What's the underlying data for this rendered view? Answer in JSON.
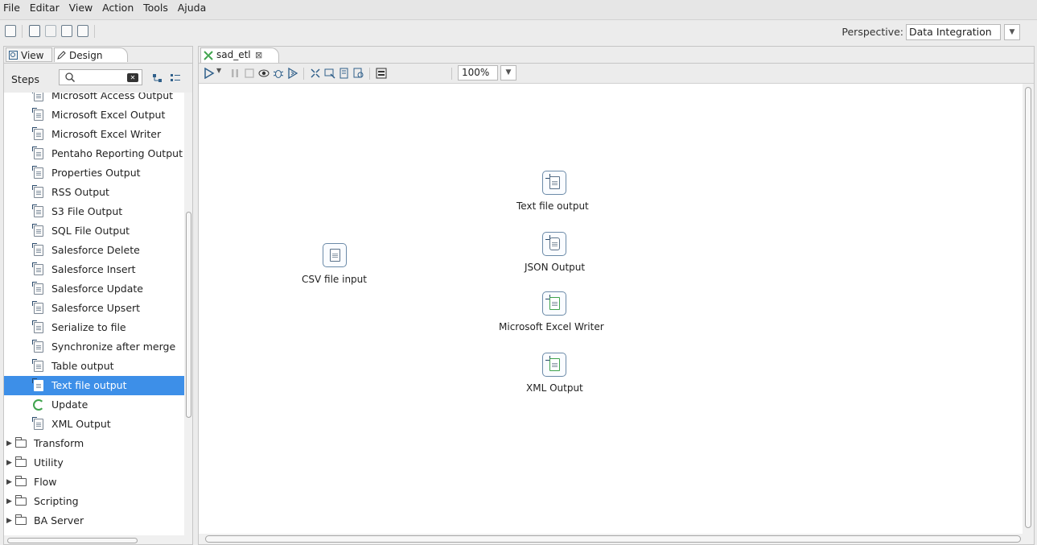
{
  "menu": [
    "File",
    "Editar",
    "View",
    "Action",
    "Tools",
    "Ajuda"
  ],
  "toolbar": {
    "perspective_label": "Perspective:",
    "perspective_value": "Data Integration"
  },
  "left_panel": {
    "tabs": {
      "view": "View",
      "design": "Design"
    },
    "steps_label": "Steps",
    "search_value": "",
    "tree": [
      {
        "label": "Microsoft Access Output",
        "type": "step"
      },
      {
        "label": "Microsoft Excel Output",
        "type": "step"
      },
      {
        "label": "Microsoft Excel Writer",
        "type": "step"
      },
      {
        "label": "Pentaho Reporting Output",
        "type": "step"
      },
      {
        "label": "Properties Output",
        "type": "step"
      },
      {
        "label": "RSS Output",
        "type": "step"
      },
      {
        "label": "S3 File Output",
        "type": "step"
      },
      {
        "label": "SQL File Output",
        "type": "step"
      },
      {
        "label": "Salesforce Delete",
        "type": "step"
      },
      {
        "label": "Salesforce Insert",
        "type": "step"
      },
      {
        "label": "Salesforce Update",
        "type": "step"
      },
      {
        "label": "Salesforce Upsert",
        "type": "step"
      },
      {
        "label": "Serialize to file",
        "type": "step"
      },
      {
        "label": "Synchronize after merge",
        "type": "step"
      },
      {
        "label": "Table output",
        "type": "step"
      },
      {
        "label": "Text file output",
        "type": "step",
        "selected": true
      },
      {
        "label": "Update",
        "type": "step"
      },
      {
        "label": "XML Output",
        "type": "step"
      },
      {
        "label": "Transform",
        "type": "category"
      },
      {
        "label": "Utility",
        "type": "category"
      },
      {
        "label": "Flow",
        "type": "category"
      },
      {
        "label": "Scripting",
        "type": "category"
      },
      {
        "label": "BA Server",
        "type": "category"
      }
    ]
  },
  "editor": {
    "tab_label": "sad_etl",
    "zoom": "100%",
    "nodes": {
      "text_file_output": "Text file output",
      "json_output": "JSON Output",
      "excel_writer": "Microsoft Excel Writer",
      "xml_output": "XML Output",
      "csv_input": "CSV file input"
    }
  },
  "colors": {
    "selection": "#3d8fe8",
    "accent_green": "#3fa34d"
  }
}
